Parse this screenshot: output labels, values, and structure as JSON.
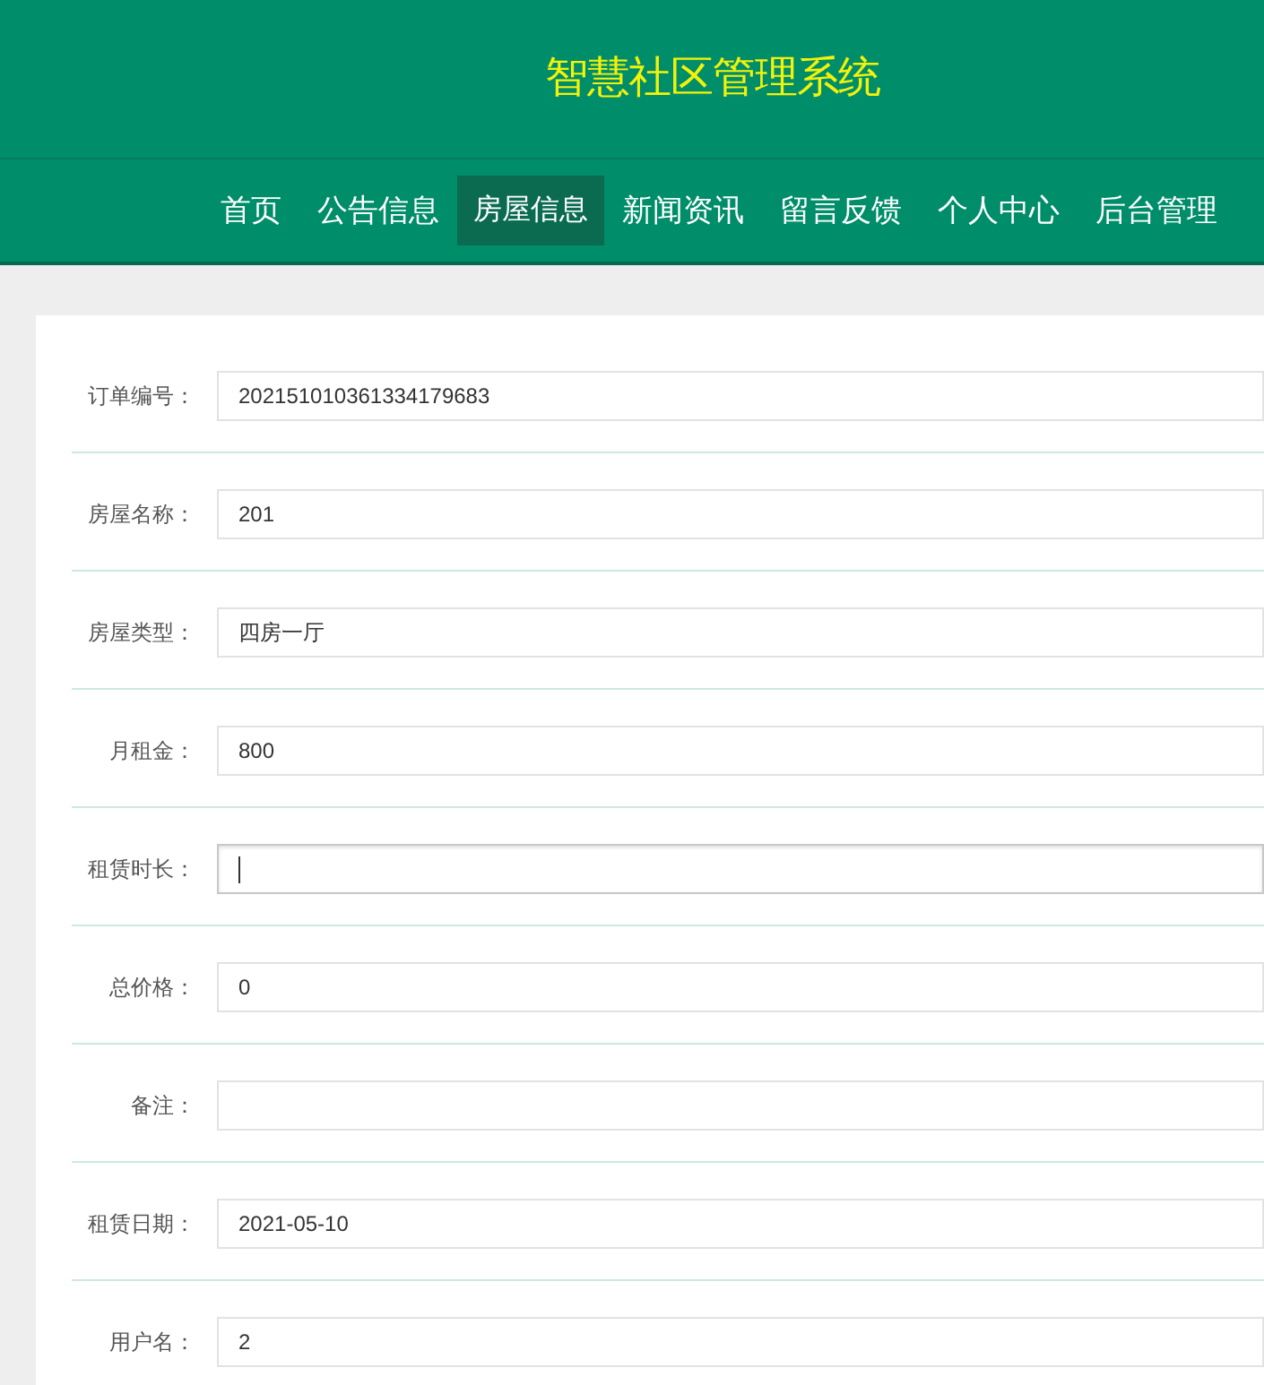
{
  "header": {
    "title": "智慧社区管理系统"
  },
  "nav": [
    {
      "label": "首页",
      "selected": false
    },
    {
      "label": "公告信息",
      "selected": false
    },
    {
      "label": "房屋信息",
      "selected": true
    },
    {
      "label": "新闻资讯",
      "selected": false
    },
    {
      "label": "留言反馈",
      "selected": false
    },
    {
      "label": "个人中心",
      "selected": false
    },
    {
      "label": "后台管理",
      "selected": false
    }
  ],
  "form": {
    "fields": [
      {
        "label": "订单编号：",
        "value": "202151010361334179683"
      },
      {
        "label": "房屋名称：",
        "value": "201"
      },
      {
        "label": "房屋类型：",
        "value": "四房一厅"
      },
      {
        "label": "月租金：",
        "value": "800"
      },
      {
        "label": "租赁时长：",
        "focused": true
      },
      {
        "label": "总价格：",
        "value": "0"
      },
      {
        "label": "备注："
      },
      {
        "label": "租赁日期：",
        "value": "2021-05-10"
      },
      {
        "label": "用户名：",
        "value": "2"
      }
    ]
  }
}
